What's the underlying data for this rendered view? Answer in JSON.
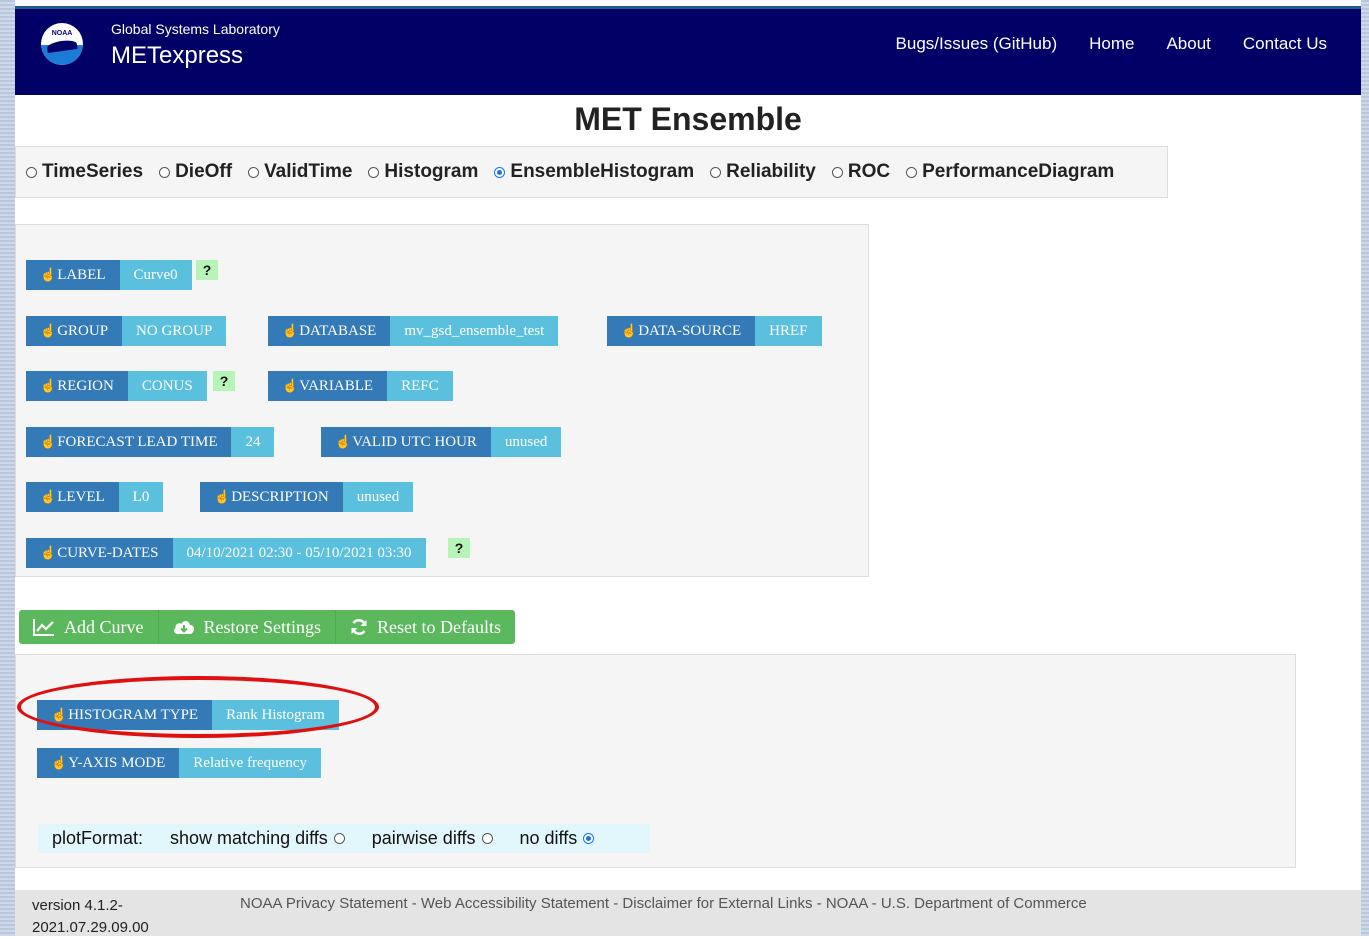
{
  "header": {
    "logo_text": "NOAA",
    "lab": "Global Systems Laboratory",
    "app_name": "METexpress",
    "nav": [
      "Bugs/Issues (GitHub)",
      "Home",
      "About",
      "Contact Us"
    ],
    "bg_color": "#000066"
  },
  "page_title": "MET Ensemble",
  "plot_types": [
    {
      "label": "TimeSeries",
      "selected": false
    },
    {
      "label": "DieOff",
      "selected": false
    },
    {
      "label": "ValidTime",
      "selected": false
    },
    {
      "label": "Histogram",
      "selected": false
    },
    {
      "label": "EnsembleHistogram",
      "selected": true
    },
    {
      "label": "Reliability",
      "selected": false
    },
    {
      "label": "ROC",
      "selected": false
    },
    {
      "label": "PerformanceDiagram",
      "selected": false
    }
  ],
  "curve_params": {
    "label": {
      "name": "LABEL",
      "value": "Curve0"
    },
    "group": {
      "name": "GROUP",
      "value": "NO GROUP"
    },
    "database": {
      "name": "DATABASE",
      "value": "mv_gsd_ensemble_test"
    },
    "data_source": {
      "name": "DATA-SOURCE",
      "value": "HREF"
    },
    "region": {
      "name": "REGION",
      "value": "CONUS"
    },
    "variable": {
      "name": "VARIABLE",
      "value": "REFC"
    },
    "forecast_lead": {
      "name": "FORECAST LEAD TIME",
      "value": "24"
    },
    "valid_hour": {
      "name": "VALID UTC HOUR",
      "value": "unused"
    },
    "level": {
      "name": "LEVEL",
      "value": "L0"
    },
    "description": {
      "name": "DESCRIPTION",
      "value": "unused"
    },
    "curve_dates": {
      "name": "CURVE-DATES",
      "value": "04/10/2021 02:30 - 05/10/2021 03:30"
    },
    "help": "?"
  },
  "actions": {
    "add_curve": "Add Curve",
    "restore": "Restore Settings",
    "reset": "Reset to Defaults"
  },
  "plot_options": {
    "histogram_type": {
      "name": "HISTOGRAM TYPE",
      "value": "Rank Histogram"
    },
    "y_axis_mode": {
      "name": "Y-AXIS MODE",
      "value": "Relative frequency"
    }
  },
  "plot_format": {
    "label": "plotFormat:",
    "options": [
      {
        "label": "show matching diffs",
        "selected": false
      },
      {
        "label": "pairwise diffs",
        "selected": false
      },
      {
        "label": "no diffs",
        "selected": true
      }
    ]
  },
  "footer": {
    "version_line1": "version 4.1.2-",
    "version_line2": "2021.07.29.09.00",
    "links": [
      "NOAA Privacy Statement",
      "Web Accessibility Statement",
      "Disclaimer for External Links",
      "NOAA",
      "U.S. Department of Commerce"
    ],
    "separator": " - "
  },
  "colors": {
    "selector_key": "#337ab7",
    "selector_value": "#5bc0de",
    "action_green": "#5cb85c",
    "highlight_red": "#e01010"
  }
}
